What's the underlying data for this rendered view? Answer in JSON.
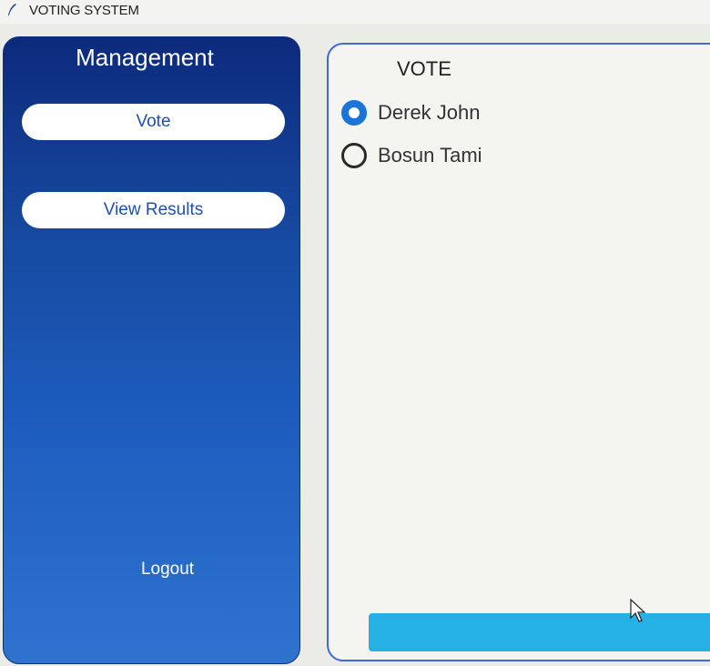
{
  "window": {
    "title": "VOTING SYSTEM",
    "icon": "feather-icon"
  },
  "sidebar": {
    "title": "Management",
    "vote_label": "Vote",
    "results_label": "View Results",
    "logout_label": "Logout"
  },
  "ballot": {
    "title": "VOTE",
    "candidates": [
      {
        "name": "Derek John",
        "selected": true
      },
      {
        "name": "Bosun Tami",
        "selected": false
      }
    ],
    "submit_label": ""
  },
  "colors": {
    "sidebar_top": "#0c2a7c",
    "sidebar_bottom": "#2f73cf",
    "panel_border": "#3f6ad6",
    "radio_selected": "#1b74d8",
    "submit_button": "#25b1e3"
  }
}
